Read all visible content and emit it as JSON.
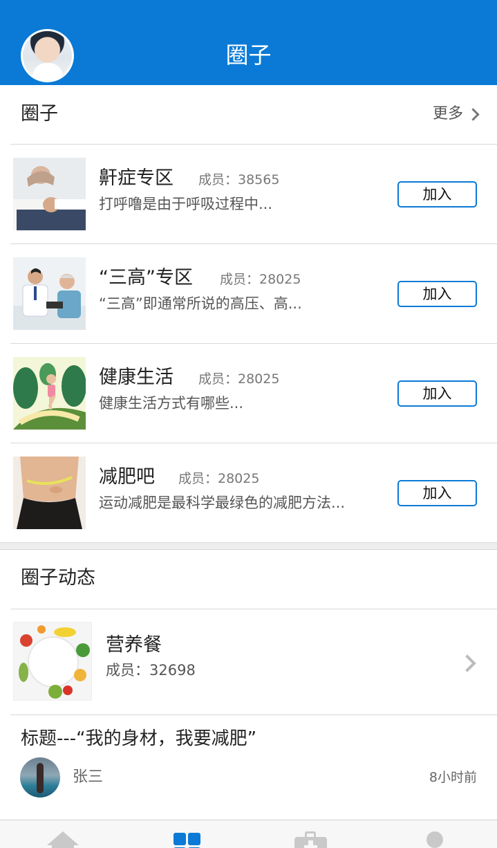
{
  "header": {
    "title": "圈子",
    "avatar_icon": "user-avatar-photo"
  },
  "circles_section": {
    "title": "圈子",
    "more_label": "更多",
    "more_icon": "chevron-right-icon",
    "items": [
      {
        "name": "鼾症专区",
        "members": "成员：38565",
        "desc": "打呼噜是由于呼吸过程中...",
        "join_label": "加入",
        "thumb": "sleeping-person-photo"
      },
      {
        "name": "“三高”专区",
        "members": "成员：28025",
        "desc": "“三高”即通常所说的高压、高...",
        "join_label": "加入",
        "thumb": "doctor-blood-pressure-photo"
      },
      {
        "name": "健康生活",
        "members": "成员：28025",
        "desc": "健康生活方式有哪些...",
        "join_label": "加入",
        "thumb": "jogging-illustration"
      },
      {
        "name": "减肥吧",
        "members": "成员：28025",
        "desc": "运动减肥是最科学最绿色的减肥方法...",
        "join_label": "加入",
        "thumb": "waist-measuring-photo"
      }
    ]
  },
  "feed_section": {
    "title": "圈子动态",
    "group": {
      "name": "营养餐",
      "members": "成员：32698",
      "thumb": "fruit-plate-photo",
      "chevron_icon": "chevron-right-icon"
    },
    "post": {
      "title": "标题---“我的身材，我要减肥”",
      "author": "张三",
      "time": "8小时前",
      "avatar": "user-avatar-photo"
    }
  },
  "tabbar": {
    "tabs": [
      {
        "icon": "home-icon",
        "active": false
      },
      {
        "icon": "grid-icon",
        "active": true
      },
      {
        "icon": "medical-kit-icon",
        "active": false
      },
      {
        "icon": "person-icon",
        "active": false
      }
    ],
    "active_color": "#0a7ad6",
    "inactive_color": "#c9c9c9"
  },
  "colors": {
    "brand": "#0a7ad6",
    "divider": "#d8d8d8"
  }
}
